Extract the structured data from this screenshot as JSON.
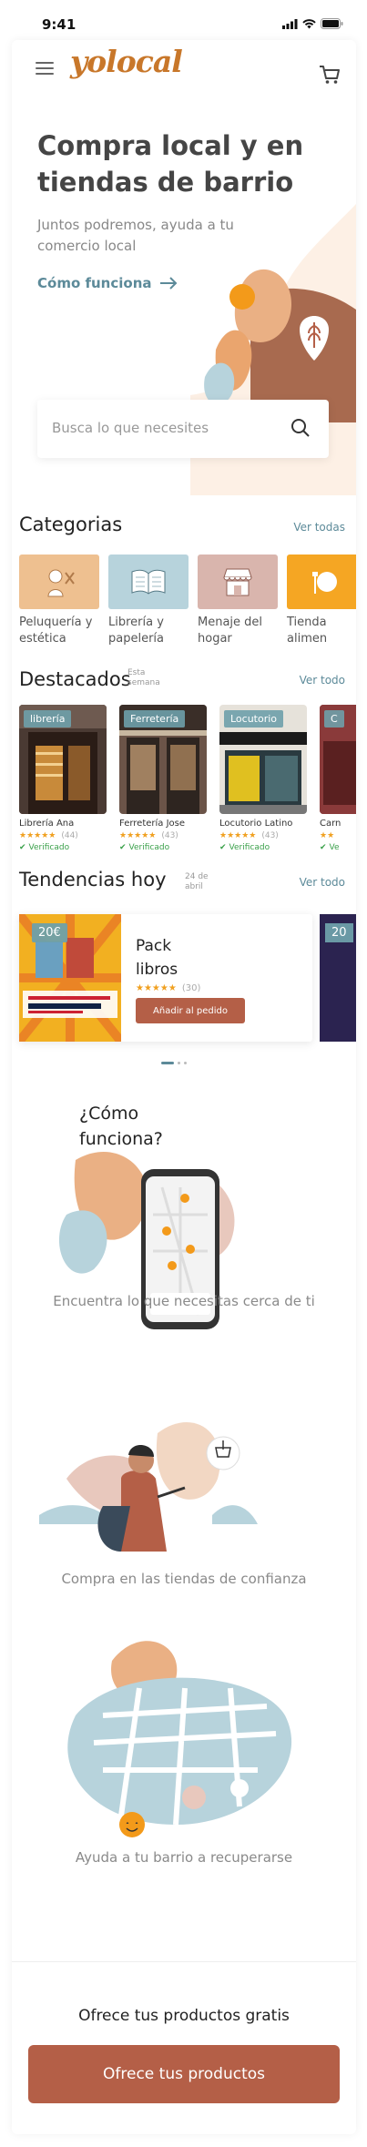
{
  "status_bar": {
    "time": "9:41"
  },
  "header": {
    "logo_text": "yolocal",
    "brand_color": "#c8772a"
  },
  "hero": {
    "title": "Compra local y en tiendas de barrio",
    "subtitle": "Juntos podremos, ayuda a tu comercio local",
    "how_link": "Cómo funciona"
  },
  "search": {
    "placeholder": "Busca lo que necesites"
  },
  "categories": {
    "title": "Categorias",
    "view_all": "Ver todas",
    "items": [
      {
        "label": "Peluquería y estética",
        "color": "#eec090",
        "icon": "hair-salon-icon"
      },
      {
        "label": "Librería y papelería",
        "color": "#b7d3dc",
        "icon": "book-icon"
      },
      {
        "label": "Menaje del hogar",
        "color": "#d9b5ad",
        "icon": "store-icon"
      },
      {
        "label": "Tienda alimen",
        "color": "#f5a623",
        "icon": "food-icon"
      }
    ]
  },
  "featured": {
    "title": "Destacados",
    "note": "Esta semana",
    "view_all": "Ver todo",
    "items": [
      {
        "tag": "librería",
        "name": "Librería Ana",
        "stars": "★★★★★",
        "count": "(44)",
        "verified": "Verificado"
      },
      {
        "tag": "Ferretería",
        "name": "Ferretería Jose",
        "stars": "★★★★★",
        "count": "(43)",
        "verified": "Verificado"
      },
      {
        "tag": "Locutorio",
        "name": "Locutorio Latino",
        "stars": "★★★★★",
        "count": "(43)",
        "verified": "Verificado"
      },
      {
        "tag": "C",
        "name": "Carn",
        "stars": "★★",
        "count": "",
        "verified": "Ve"
      }
    ]
  },
  "trends": {
    "title": "Tendencias hoy",
    "date": "24 de abril",
    "view_all": "Ver todo",
    "item": {
      "price": "20€",
      "name": "Pack libros",
      "stars": "★★★★★",
      "count": "(30)",
      "button": "Añadir al pedido"
    },
    "next_price": "20"
  },
  "how_it_works": {
    "title": "¿Cómo funciona?",
    "steps": [
      "Encuentra lo que necesitas cerca de ti",
      "Compra en las tiendas de confianza",
      "Ayuda a tu barrio a recuperarse"
    ]
  },
  "offer": {
    "text": "Ofrece tus productos gratis",
    "button": "Ofrece tus  productos",
    "button_color": "#b45f47"
  }
}
